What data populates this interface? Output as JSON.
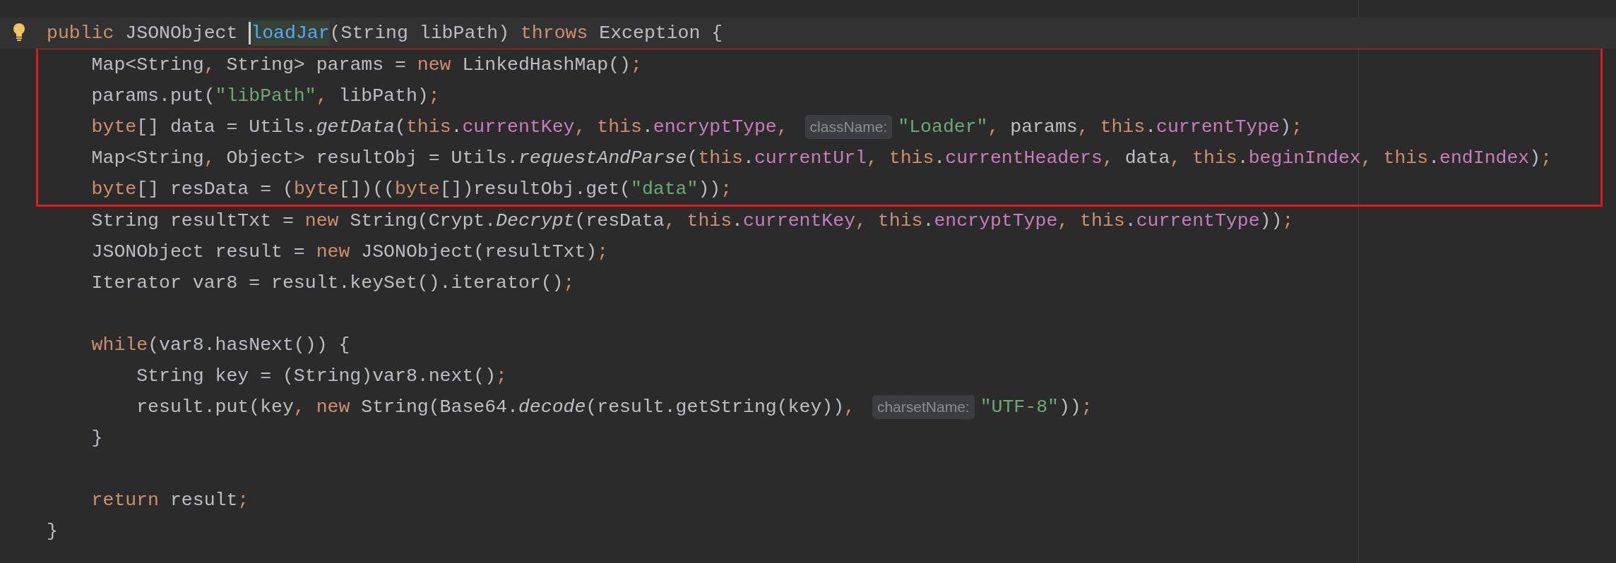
{
  "editor": {
    "lines": [
      {
        "kind": "code",
        "current": true,
        "boxed": false,
        "intention_bulb": true,
        "tokens": [
          {
            "kind": "kw",
            "text": "public "
          },
          {
            "kind": "plain",
            "text": "JSONObject "
          },
          {
            "kind": "cursor"
          },
          {
            "kind": "decl",
            "text": "loadJar"
          },
          {
            "kind": "plain",
            "text": "(String libPath) "
          },
          {
            "kind": "kw",
            "text": "throws "
          },
          {
            "kind": "plain",
            "text": "Exception {"
          }
        ]
      },
      {
        "kind": "code",
        "current": false,
        "boxed": true,
        "tokens": [
          {
            "kind": "plain",
            "text": "    Map<String"
          },
          {
            "kind": "kw",
            "text": ", "
          },
          {
            "kind": "plain",
            "text": "String> params = "
          },
          {
            "kind": "kw",
            "text": "new "
          },
          {
            "kind": "plain",
            "text": "LinkedHashMap()"
          },
          {
            "kind": "kw",
            "text": ";"
          }
        ]
      },
      {
        "kind": "code",
        "current": false,
        "boxed": true,
        "tokens": [
          {
            "kind": "plain",
            "text": "    params.put("
          },
          {
            "kind": "str",
            "text": "\"libPath\""
          },
          {
            "kind": "kw",
            "text": ", "
          },
          {
            "kind": "plain",
            "text": "libPath)"
          },
          {
            "kind": "kw",
            "text": ";"
          }
        ]
      },
      {
        "kind": "code",
        "current": false,
        "boxed": true,
        "tokens": [
          {
            "kind": "kw",
            "text": "    byte"
          },
          {
            "kind": "plain",
            "text": "[] data = Utils."
          },
          {
            "kind": "call",
            "text": "getData"
          },
          {
            "kind": "plain",
            "text": "("
          },
          {
            "kind": "kw",
            "text": "this"
          },
          {
            "kind": "plain",
            "text": "."
          },
          {
            "kind": "field",
            "text": "currentKey"
          },
          {
            "kind": "kw",
            "text": ", this"
          },
          {
            "kind": "plain",
            "text": "."
          },
          {
            "kind": "field",
            "text": "encryptType"
          },
          {
            "kind": "kw",
            "text": ", "
          },
          {
            "kind": "hint",
            "text": "className:"
          },
          {
            "kind": "str",
            "text": "\"Loader\""
          },
          {
            "kind": "kw",
            "text": ", "
          },
          {
            "kind": "plain",
            "text": "params"
          },
          {
            "kind": "kw",
            "text": ", this"
          },
          {
            "kind": "plain",
            "text": "."
          },
          {
            "kind": "field",
            "text": "currentType"
          },
          {
            "kind": "plain",
            "text": ")"
          },
          {
            "kind": "kw",
            "text": ";"
          }
        ]
      },
      {
        "kind": "code",
        "current": false,
        "boxed": true,
        "tokens": [
          {
            "kind": "plain",
            "text": "    Map<String"
          },
          {
            "kind": "kw",
            "text": ", "
          },
          {
            "kind": "plain",
            "text": "Object> resultObj = Utils."
          },
          {
            "kind": "call",
            "text": "requestAndParse"
          },
          {
            "kind": "plain",
            "text": "("
          },
          {
            "kind": "kw",
            "text": "this"
          },
          {
            "kind": "plain",
            "text": "."
          },
          {
            "kind": "field",
            "text": "currentUrl"
          },
          {
            "kind": "kw",
            "text": ", this"
          },
          {
            "kind": "plain",
            "text": "."
          },
          {
            "kind": "field",
            "text": "currentHeaders"
          },
          {
            "kind": "kw",
            "text": ", "
          },
          {
            "kind": "plain",
            "text": "data"
          },
          {
            "kind": "kw",
            "text": ", this"
          },
          {
            "kind": "plain",
            "text": "."
          },
          {
            "kind": "field",
            "text": "beginIndex"
          },
          {
            "kind": "kw",
            "text": ", this"
          },
          {
            "kind": "plain",
            "text": "."
          },
          {
            "kind": "field",
            "text": "endIndex"
          },
          {
            "kind": "plain",
            "text": ")"
          },
          {
            "kind": "kw",
            "text": ";"
          }
        ]
      },
      {
        "kind": "code",
        "current": false,
        "boxed": true,
        "tokens": [
          {
            "kind": "kw",
            "text": "    byte"
          },
          {
            "kind": "plain",
            "text": "[] resData = ("
          },
          {
            "kind": "kw",
            "text": "byte"
          },
          {
            "kind": "plain",
            "text": "[])(("
          },
          {
            "kind": "kw",
            "text": "byte"
          },
          {
            "kind": "plain",
            "text": "[])resultObj.get("
          },
          {
            "kind": "str",
            "text": "\"data\""
          },
          {
            "kind": "plain",
            "text": "))"
          },
          {
            "kind": "kw",
            "text": ";"
          }
        ]
      },
      {
        "kind": "code",
        "current": false,
        "boxed": false,
        "tokens": [
          {
            "kind": "plain",
            "text": "    String resultTxt = "
          },
          {
            "kind": "kw",
            "text": "new "
          },
          {
            "kind": "plain",
            "text": "String(Crypt."
          },
          {
            "kind": "call",
            "text": "Decrypt"
          },
          {
            "kind": "plain",
            "text": "(resData"
          },
          {
            "kind": "kw",
            "text": ", this"
          },
          {
            "kind": "plain",
            "text": "."
          },
          {
            "kind": "field",
            "text": "currentKey"
          },
          {
            "kind": "kw",
            "text": ", this"
          },
          {
            "kind": "plain",
            "text": "."
          },
          {
            "kind": "field",
            "text": "encryptType"
          },
          {
            "kind": "kw",
            "text": ", this"
          },
          {
            "kind": "plain",
            "text": "."
          },
          {
            "kind": "field",
            "text": "currentType"
          },
          {
            "kind": "plain",
            "text": "))"
          },
          {
            "kind": "kw",
            "text": ";"
          }
        ]
      },
      {
        "kind": "code",
        "current": false,
        "boxed": false,
        "tokens": [
          {
            "kind": "plain",
            "text": "    JSONObject result = "
          },
          {
            "kind": "kw",
            "text": "new "
          },
          {
            "kind": "plain",
            "text": "JSONObject(resultTxt)"
          },
          {
            "kind": "kw",
            "text": ";"
          }
        ]
      },
      {
        "kind": "code",
        "current": false,
        "boxed": false,
        "tokens": [
          {
            "kind": "plain",
            "text": "    Iterator var8 = result.keySet().iterator()"
          },
          {
            "kind": "kw",
            "text": ";"
          }
        ]
      },
      {
        "kind": "blank"
      },
      {
        "kind": "code",
        "current": false,
        "boxed": false,
        "tokens": [
          {
            "kind": "kw",
            "text": "    while"
          },
          {
            "kind": "plain",
            "text": "(var8.hasNext()) {"
          }
        ]
      },
      {
        "kind": "code",
        "current": false,
        "boxed": false,
        "tokens": [
          {
            "kind": "plain",
            "text": "        String key = (String)var8.next()"
          },
          {
            "kind": "kw",
            "text": ";"
          }
        ]
      },
      {
        "kind": "code",
        "current": false,
        "boxed": false,
        "tokens": [
          {
            "kind": "plain",
            "text": "        result.put(key"
          },
          {
            "kind": "kw",
            "text": ", new "
          },
          {
            "kind": "plain",
            "text": "String(Base64."
          },
          {
            "kind": "call",
            "text": "decode"
          },
          {
            "kind": "plain",
            "text": "(result.getString(key))"
          },
          {
            "kind": "kw",
            "text": ", "
          },
          {
            "kind": "hint",
            "text": "charsetName:"
          },
          {
            "kind": "str",
            "text": "\"UTF-8\""
          },
          {
            "kind": "plain",
            "text": "))"
          },
          {
            "kind": "kw",
            "text": ";"
          }
        ]
      },
      {
        "kind": "code",
        "current": false,
        "boxed": false,
        "tokens": [
          {
            "kind": "plain",
            "text": "    }"
          }
        ]
      },
      {
        "kind": "blank"
      },
      {
        "kind": "code",
        "current": false,
        "boxed": false,
        "tokens": [
          {
            "kind": "kw",
            "text": "    return "
          },
          {
            "kind": "plain",
            "text": "result"
          },
          {
            "kind": "kw",
            "text": ";"
          }
        ]
      },
      {
        "kind": "code",
        "current": false,
        "boxed": false,
        "tokens": [
          {
            "kind": "plain",
            "text": "}"
          }
        ]
      }
    ]
  }
}
